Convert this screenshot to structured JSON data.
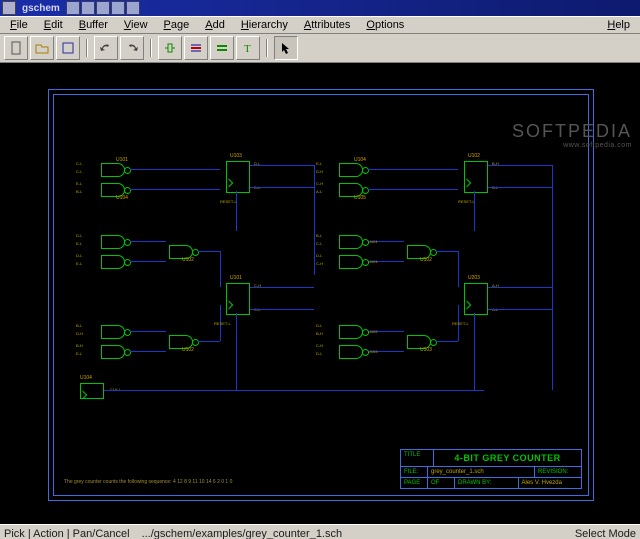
{
  "window": {
    "title": "gschem"
  },
  "menu": {
    "items": [
      "File",
      "Edit",
      "Buffer",
      "View",
      "Page",
      "Add",
      "Hierarchy",
      "Attributes",
      "Options"
    ],
    "help": "Help"
  },
  "toolbar": {
    "items": [
      {
        "name": "new-file-icon"
      },
      {
        "name": "open-file-icon"
      },
      {
        "name": "save-file-icon"
      },
      {
        "name": "sep"
      },
      {
        "name": "undo-icon"
      },
      {
        "name": "redo-icon"
      },
      {
        "name": "sep"
      },
      {
        "name": "add-component-icon"
      },
      {
        "name": "add-net-icon"
      },
      {
        "name": "add-bus-icon"
      },
      {
        "name": "add-text-icon"
      },
      {
        "name": "sep"
      },
      {
        "name": "select-mode-icon",
        "active": true
      }
    ]
  },
  "watermark": {
    "text": "SOFTPEDIA",
    "sub": "www.softpedia.com"
  },
  "schematic": {
    "components": [
      {
        "ref": "U101"
      },
      {
        "ref": "U104"
      },
      {
        "ref": "U105"
      },
      {
        "ref": "U105"
      },
      {
        "ref": "U103"
      },
      {
        "ref": "U104"
      },
      {
        "ref": "U102"
      },
      {
        "ref": "U101"
      },
      {
        "ref": "U101"
      },
      {
        "ref": "U102"
      },
      {
        "ref": "U102"
      },
      {
        "ref": "U101"
      },
      {
        "ref": "U402"
      },
      {
        "ref": "U203"
      },
      {
        "ref": "U103"
      },
      {
        "ref": "U103"
      },
      {
        "ref": "U104"
      }
    ],
    "nets": [
      "C-L",
      "C-L",
      "E-L",
      "B-L",
      "D-L",
      "E-L",
      "D-H",
      "D-L",
      "C-H",
      "E-L",
      "D-H",
      "A-L",
      "C-L",
      "D-H",
      "C-L",
      "D-L",
      "C-H",
      "A-H",
      "B-H",
      "B-L",
      "A-H",
      "CLK-L",
      "RESET-L",
      "RESET-L",
      "RESET-L",
      "RESET-L"
    ],
    "note": "The grey counter counts the following sequence: 4 12 8 9 11 10 14 6 2 0 1 0"
  },
  "titleblock": {
    "title_label": "TITLE",
    "title": "4-BIT GREY COUNTER",
    "file_label": "FILE:",
    "file": "grey_counter_1.sch",
    "rev_label": "REVISION:",
    "rev": "",
    "page_label": "PAGE",
    "page_of_label": "OF",
    "drawn_label": "DRAWN BY:",
    "drawn": "Ales V. Hvezda"
  },
  "statusbar": {
    "left": "Pick | Action | Pan/Cancel",
    "path": ".../gschem/examples/grey_counter_1.sch",
    "mode": "Select Mode"
  }
}
